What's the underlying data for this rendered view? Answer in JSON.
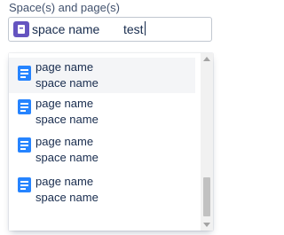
{
  "field_label": "Space(s) and page(s)",
  "selected_space": {
    "label": "space name",
    "icon": "space-avatar-icon"
  },
  "search_input": {
    "value": "test"
  },
  "results": [
    {
      "title": "page name",
      "subtitle": "space name",
      "icon": "page-icon",
      "active": true
    },
    {
      "title": "page name",
      "subtitle": "space name",
      "icon": "page-icon",
      "active": false
    },
    {
      "title": "page name",
      "subtitle": "space name",
      "icon": "page-icon",
      "active": false
    },
    {
      "title": "page name",
      "subtitle": "space name",
      "icon": "page-icon",
      "active": false
    }
  ],
  "colors": {
    "page_icon": "#2684ff",
    "space_icon": "#6554c0",
    "active_row": "#f4f5f7"
  }
}
